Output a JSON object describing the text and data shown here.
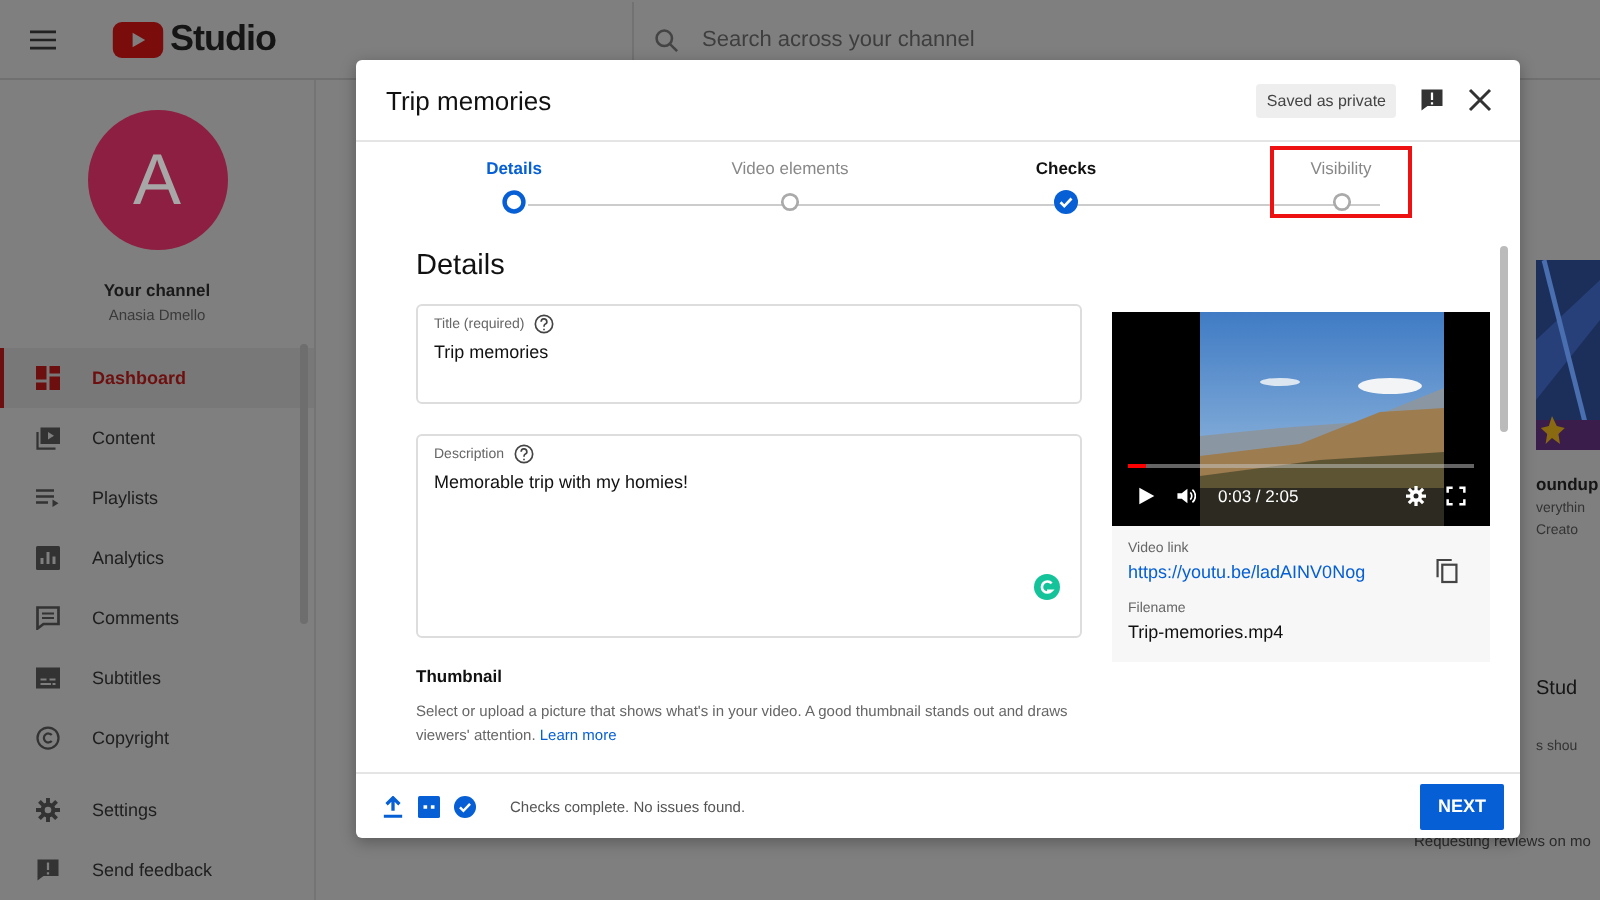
{
  "topbar": {
    "logo": "Studio",
    "search": {
      "placeholder": "Search across your channel"
    }
  },
  "sidebar": {
    "avatar": "A",
    "channel_title": "Your channel",
    "channel_name": "Anasia Dmello",
    "items": [
      {
        "label": "Dashboard",
        "selected": true
      },
      {
        "label": "Content",
        "selected": false
      },
      {
        "label": "Playlists",
        "selected": false
      },
      {
        "label": "Analytics",
        "selected": false
      },
      {
        "label": "Comments",
        "selected": false
      },
      {
        "label": "Subtitles",
        "selected": false
      },
      {
        "label": "Copyright",
        "selected": false
      },
      {
        "label": "Settings",
        "selected": false
      },
      {
        "label": "Send feedback",
        "selected": false
      }
    ]
  },
  "background": {
    "card_title": "oundup",
    "card_lines": [
      "verythin",
      "Creato"
    ],
    "section_title": "Stud",
    "section_text": "s shou",
    "footer_text": "Requesting reviews on mo"
  },
  "dialog": {
    "title": "Trip memories",
    "save_status": "Saved as private",
    "steps": [
      {
        "label": "Details",
        "selected": true,
        "done": false,
        "highlighted": false
      },
      {
        "label": "Video elements",
        "selected": false,
        "done": false,
        "highlighted": false
      },
      {
        "label": "Checks",
        "selected": false,
        "done": true,
        "highlighted": false
      },
      {
        "label": "Visibility",
        "selected": false,
        "done": false,
        "highlighted": true
      }
    ],
    "heading": "Details",
    "fields": [
      {
        "label": "Title (required)",
        "value": "Trip memories"
      },
      {
        "label": "Description",
        "value": "Memorable trip with my homies!"
      }
    ],
    "thumbnail": {
      "heading": "Thumbnail",
      "text": "Select or upload a picture that shows what's in your video. A good thumbnail stands out and draws viewers' attention.",
      "link": "Learn more"
    },
    "video": {
      "level": 0.05,
      "time": "0:03 / 2:05",
      "link_label": "Video link",
      "link": "https://youtu.be/ladAINV0Nog",
      "filename_label": "Filename",
      "filename": "Trip-memories.mp4"
    },
    "footer": {
      "status": "Checks complete. No issues found.",
      "next": "NEXT"
    }
  }
}
